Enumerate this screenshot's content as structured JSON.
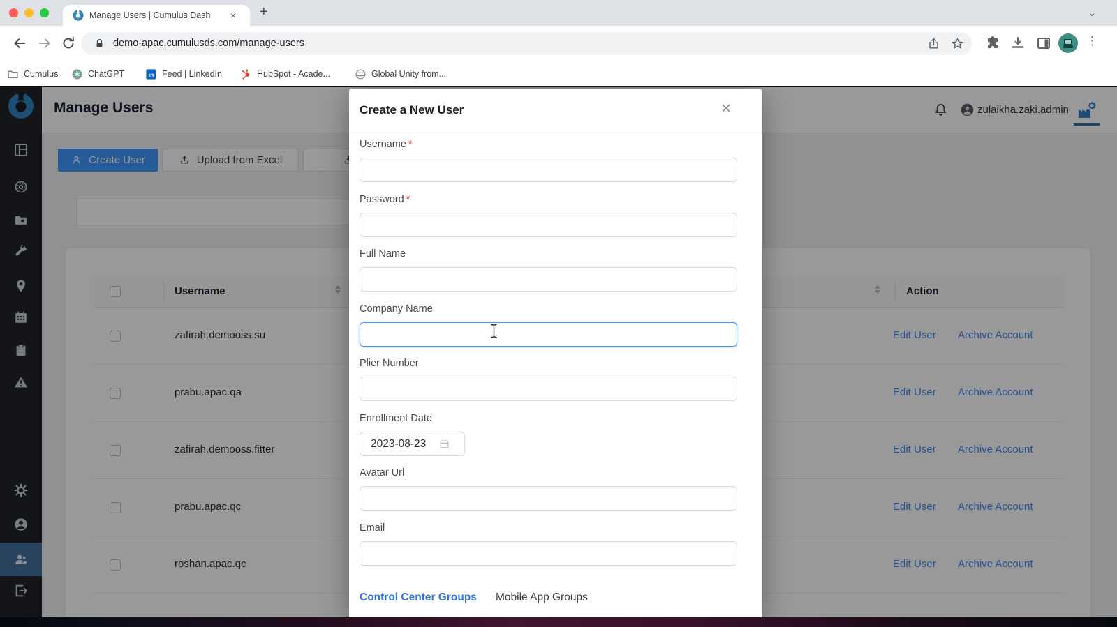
{
  "browser": {
    "tab_title": "Manage Users | Cumulus Dash",
    "tab_close": "×",
    "new_tab": "+",
    "url": "demo-apac.cumulusds.com/manage-users",
    "bookmarks": [
      {
        "label": "Cumulus"
      },
      {
        "label": "ChatGPT"
      },
      {
        "label": "Feed | LinkedIn"
      },
      {
        "label": "HubSpot - Acade..."
      },
      {
        "label": "Global Unity from..."
      }
    ]
  },
  "header": {
    "title": "Manage Users",
    "user_name": "zulaikha.zaki.admin"
  },
  "toolbar": {
    "create_user": "Create User",
    "upload_excel": "Upload from Excel"
  },
  "table": {
    "column_username": "Username",
    "column_action": "Action",
    "rows": [
      {
        "username": "zafirah.demooss.su"
      },
      {
        "username": "prabu.apac.qa"
      },
      {
        "username": "zafirah.demooss.fitter"
      },
      {
        "username": "prabu.apac.qc"
      },
      {
        "username": "roshan.apac.qc"
      }
    ],
    "actions": {
      "edit": "Edit User",
      "archive": "Archive Account"
    }
  },
  "modal": {
    "title": "Create a New User",
    "close": "×",
    "required_marker": "*",
    "fields": [
      {
        "label": "Username",
        "required": true,
        "value": ""
      },
      {
        "label": "Password",
        "required": true,
        "value": ""
      },
      {
        "label": "Full Name",
        "value": ""
      },
      {
        "label": "Company Name",
        "value": "",
        "focused": true
      },
      {
        "label": "Plier Number",
        "value": ""
      },
      {
        "label": "Enrollment Date",
        "value": "2023-08-23"
      },
      {
        "label": "Avatar Url",
        "value": ""
      },
      {
        "label": "Email",
        "value": ""
      }
    ],
    "tabs": [
      {
        "label": "Control Center Groups",
        "active": true
      },
      {
        "label": "Mobile App Groups",
        "active": false
      }
    ]
  },
  "colors": {
    "accent_blue": "#4096ff",
    "link_blue": "#4285f4",
    "sidebar_bg": "#20232b",
    "sidebar_active_bg": "#46729f",
    "logo_blue": "#2e86c1",
    "page_bg": "#f0f2f5",
    "required_red": "#f5222d",
    "overlay": "rgba(0,0,0,0.40)"
  }
}
